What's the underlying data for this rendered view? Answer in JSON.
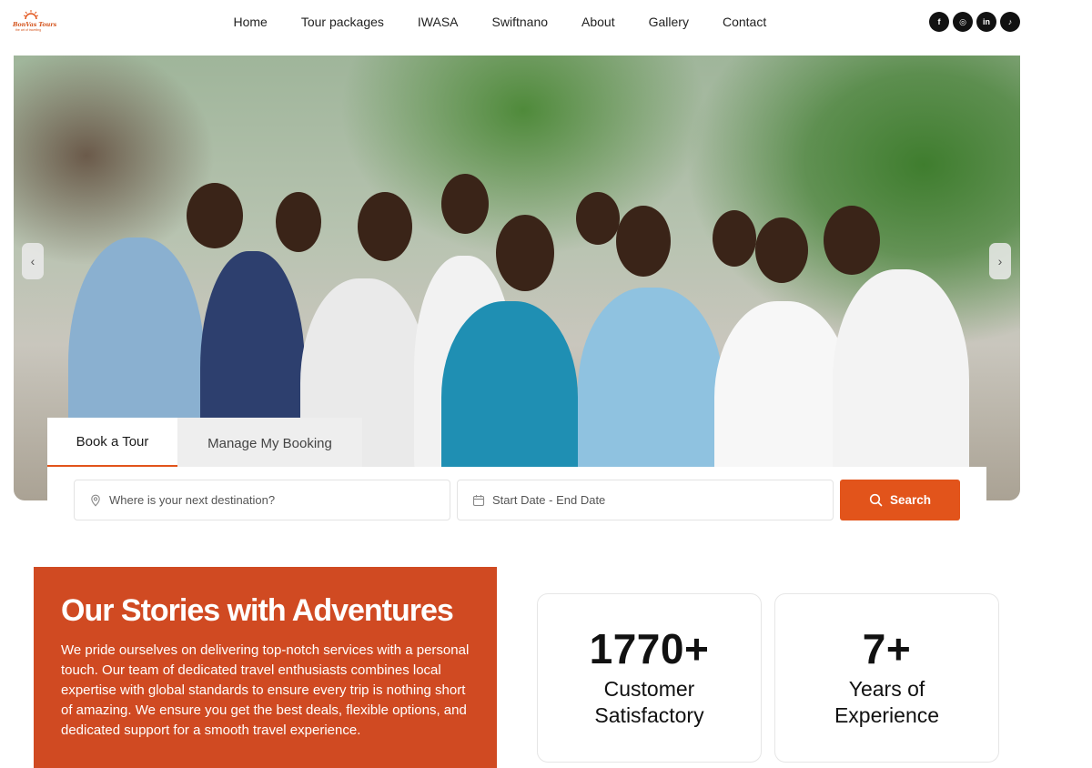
{
  "header": {
    "logo_text": "BonVas Tours",
    "logo_tagline": "the art of traveling",
    "nav": [
      "Home",
      "Tour packages",
      "IWASA",
      "Swiftnano",
      "About",
      "Gallery",
      "Contact"
    ],
    "socials": [
      {
        "icon": "facebook-icon",
        "glyph": "f"
      },
      {
        "icon": "instagram-icon",
        "glyph": "◎"
      },
      {
        "icon": "linkedin-icon",
        "glyph": "in"
      },
      {
        "icon": "tiktok-icon",
        "glyph": "♪"
      }
    ]
  },
  "hero": {
    "prev_glyph": "‹",
    "next_glyph": "›"
  },
  "booking": {
    "tabs": [
      "Book a Tour",
      "Manage My Booking"
    ],
    "destination_placeholder": "Where is your next destination?",
    "date_placeholder": "Start Date - End Date",
    "search_label": "Search"
  },
  "stories": {
    "title": "Our Stories with Adventures",
    "body": "We pride ourselves on delivering top-notch services with a personal touch. Our team of dedicated travel enthusiasts combines local expertise with global standards to ensure every trip is nothing short of amazing. We ensure you get the best deals, flexible options, and dedicated support for a smooth travel experience."
  },
  "stats": [
    {
      "value": "1770+",
      "label": "Customer Satisfactory"
    },
    {
      "value": "7+",
      "label": "Years of Experience"
    }
  ],
  "colors": {
    "accent": "#e2541b",
    "stories_bg": "#d04a22"
  }
}
